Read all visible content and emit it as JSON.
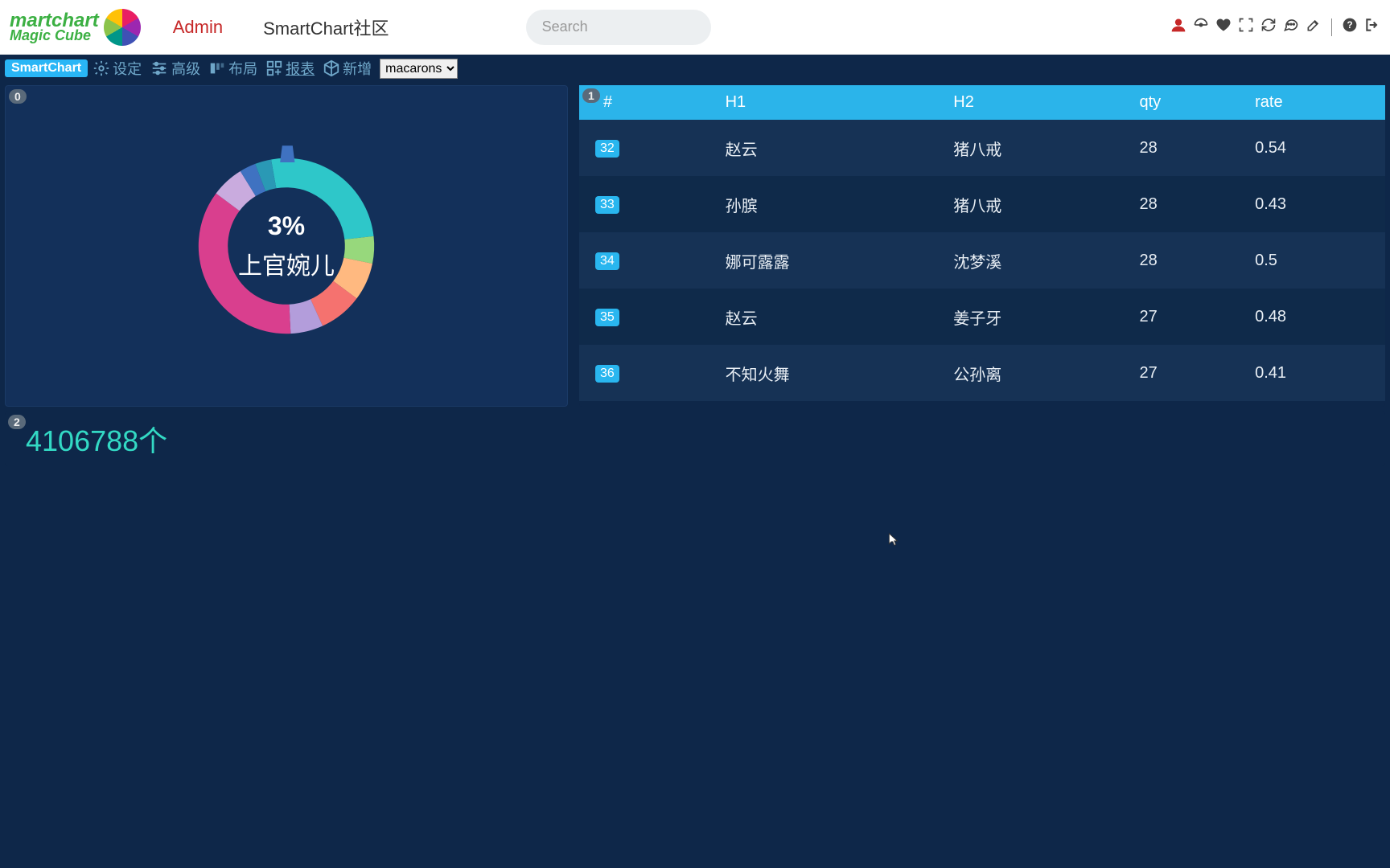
{
  "header": {
    "admin": "Admin",
    "community": "SmartChart社区",
    "search_placeholder": "Search",
    "logo_line1": "martchart",
    "logo_line2": "Magic Cube"
  },
  "toolbar": {
    "badge": "SmartChart",
    "items": [
      {
        "icon": "gear",
        "label": "设定"
      },
      {
        "icon": "sliders",
        "label": "高级"
      },
      {
        "icon": "layout",
        "label": "布局"
      },
      {
        "icon": "grid",
        "label": "报表"
      },
      {
        "icon": "cube",
        "label": "新增"
      }
    ],
    "theme_selected": "macarons"
  },
  "panels": {
    "p0_index": "0",
    "p1_index": "1",
    "p2_index": "2"
  },
  "chart_data": {
    "type": "pie",
    "title": "",
    "center_percent": "3%",
    "center_label": "上官婉儿",
    "slices": [
      {
        "name": "cyan",
        "value": 26,
        "color": "#2ec7c9"
      },
      {
        "name": "green",
        "value": 5,
        "color": "#97d87c"
      },
      {
        "name": "orange",
        "value": 7,
        "color": "#ffb980"
      },
      {
        "name": "coral",
        "value": 8,
        "color": "#f5726f"
      },
      {
        "name": "purple",
        "value": 6,
        "color": "#b39ddb"
      },
      {
        "name": "magenta",
        "value": 36,
        "color": "#d93f8e"
      },
      {
        "name": "lavender",
        "value": 6,
        "color": "#c9abde"
      },
      {
        "name": "blue",
        "value": 3,
        "color": "#3f72c1"
      },
      {
        "name": "teal",
        "value": 3,
        "color": "#2a99b5"
      }
    ]
  },
  "table": {
    "headers": [
      "#",
      "H1",
      "H2",
      "qty",
      "rate"
    ],
    "rows": [
      {
        "idx": "32",
        "h1": "赵云",
        "h2": "猪八戒",
        "qty": "28",
        "rate": "0.54"
      },
      {
        "idx": "33",
        "h1": "孙膑",
        "h2": "猪八戒",
        "qty": "28",
        "rate": "0.43"
      },
      {
        "idx": "34",
        "h1": "娜可露露",
        "h2": "沈梦溪",
        "qty": "28",
        "rate": "0.5"
      },
      {
        "idx": "35",
        "h1": "赵云",
        "h2": "姜子牙",
        "qty": "27",
        "rate": "0.48"
      },
      {
        "idx": "36",
        "h1": "不知火舞",
        "h2": "公孙离",
        "qty": "27",
        "rate": "0.41"
      }
    ]
  },
  "counter": {
    "value": "4106788",
    "unit": "个"
  }
}
